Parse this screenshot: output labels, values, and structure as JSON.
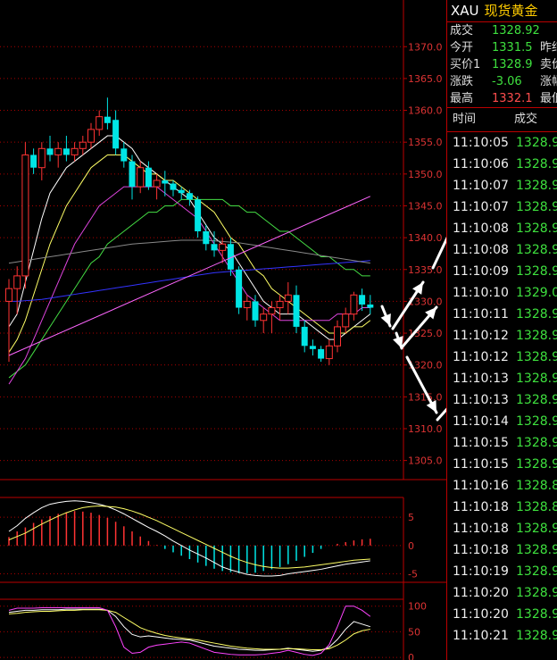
{
  "chart_data": {
    "type": "candlestick",
    "price_axis": {
      "ticks": [
        1370.0,
        1365.0,
        1360.0,
        1355.0,
        1350.0,
        1345.0,
        1340.0,
        1335.0,
        1330.0,
        1325.0,
        1320.0,
        1315.0,
        1310.0,
        1305.0
      ],
      "range": [
        1302.0,
        1372.0
      ]
    },
    "candles": [
      {
        "o": 1330.0,
        "h": 1333.5,
        "l": 1320.5,
        "c": 1332.0
      },
      {
        "o": 1332.0,
        "h": 1335.5,
        "l": 1328.0,
        "c": 1334.0
      },
      {
        "o": 1334.0,
        "h": 1355.0,
        "l": 1332.0,
        "c": 1353.0
      },
      {
        "o": 1353.0,
        "h": 1354.0,
        "l": 1350.0,
        "c": 1351.0
      },
      {
        "o": 1351.0,
        "h": 1355.0,
        "l": 1349.0,
        "c": 1354.0
      },
      {
        "o": 1354.0,
        "h": 1356.0,
        "l": 1352.0,
        "c": 1353.0
      },
      {
        "o": 1353.0,
        "h": 1355.0,
        "l": 1351.0,
        "c": 1354.0
      },
      {
        "o": 1354.0,
        "h": 1356.0,
        "l": 1352.0,
        "c": 1353.0
      },
      {
        "o": 1353.0,
        "h": 1355.0,
        "l": 1352.0,
        "c": 1354.0
      },
      {
        "o": 1354.0,
        "h": 1356.0,
        "l": 1353.0,
        "c": 1355.0
      },
      {
        "o": 1355.0,
        "h": 1358.0,
        "l": 1354.0,
        "c": 1357.0
      },
      {
        "o": 1357.0,
        "h": 1360.0,
        "l": 1356.0,
        "c": 1359.0
      },
      {
        "o": 1359.0,
        "h": 1362.0,
        "l": 1357.0,
        "c": 1358.0
      },
      {
        "o": 1358.5,
        "h": 1360.0,
        "l": 1353.0,
        "c": 1354.0
      },
      {
        "o": 1354.0,
        "h": 1355.0,
        "l": 1351.0,
        "c": 1352.0
      },
      {
        "o": 1352.0,
        "h": 1353.0,
        "l": 1346.0,
        "c": 1348.0
      },
      {
        "o": 1348.0,
        "h": 1352.0,
        "l": 1347.0,
        "c": 1351.0
      },
      {
        "o": 1351.0,
        "h": 1352.0,
        "l": 1347.5,
        "c": 1348.0
      },
      {
        "o": 1348.0,
        "h": 1350.0,
        "l": 1346.0,
        "c": 1349.0
      },
      {
        "o": 1349.0,
        "h": 1350.5,
        "l": 1346.5,
        "c": 1348.5
      },
      {
        "o": 1348.5,
        "h": 1349.0,
        "l": 1346.5,
        "c": 1347.5
      },
      {
        "o": 1347.5,
        "h": 1348.0,
        "l": 1346.0,
        "c": 1347.0
      },
      {
        "o": 1347.0,
        "h": 1347.5,
        "l": 1345.0,
        "c": 1346.0
      },
      {
        "o": 1346.0,
        "h": 1346.5,
        "l": 1340.0,
        "c": 1341.0
      },
      {
        "o": 1341.0,
        "h": 1342.0,
        "l": 1338.0,
        "c": 1339.0
      },
      {
        "o": 1339.0,
        "h": 1341.0,
        "l": 1337.0,
        "c": 1338.0
      },
      {
        "o": 1338.0,
        "h": 1340.0,
        "l": 1336.0,
        "c": 1339.0
      },
      {
        "o": 1339.0,
        "h": 1340.0,
        "l": 1334.0,
        "c": 1335.0
      },
      {
        "o": 1335.0,
        "h": 1335.5,
        "l": 1328.0,
        "c": 1329.0
      },
      {
        "o": 1329.0,
        "h": 1331.0,
        "l": 1327.0,
        "c": 1330.0
      },
      {
        "o": 1330.0,
        "h": 1331.0,
        "l": 1326.0,
        "c": 1327.0
      },
      {
        "o": 1327.0,
        "h": 1329.0,
        "l": 1325.0,
        "c": 1328.0
      },
      {
        "o": 1328.0,
        "h": 1330.0,
        "l": 1325.0,
        "c": 1329.0
      },
      {
        "o": 1329.0,
        "h": 1331.0,
        "l": 1327.0,
        "c": 1330.0
      },
      {
        "o": 1330.0,
        "h": 1333.0,
        "l": 1328.0,
        "c": 1331.0
      },
      {
        "o": 1331.0,
        "h": 1332.5,
        "l": 1325.0,
        "c": 1326.0
      },
      {
        "o": 1326.0,
        "h": 1327.0,
        "l": 1322.0,
        "c": 1323.0
      },
      {
        "o": 1323.0,
        "h": 1324.0,
        "l": 1321.5,
        "c": 1322.5
      },
      {
        "o": 1322.5,
        "h": 1323.0,
        "l": 1320.5,
        "c": 1321.0
      },
      {
        "o": 1321.0,
        "h": 1324.0,
        "l": 1320.0,
        "c": 1323.0
      },
      {
        "o": 1323.0,
        "h": 1327.0,
        "l": 1322.0,
        "c": 1326.0
      },
      {
        "o": 1326.0,
        "h": 1329.0,
        "l": 1325.0,
        "c": 1328.0
      },
      {
        "o": 1328.0,
        "h": 1331.5,
        "l": 1327.0,
        "c": 1331.0
      },
      {
        "o": 1331.0,
        "h": 1332.0,
        "l": 1328.5,
        "c": 1329.5
      },
      {
        "o": 1329.5,
        "h": 1331.0,
        "l": 1328.0,
        "c": 1329.0
      }
    ],
    "moving_averages": [
      {
        "color": "#ffffff",
        "values": [
          1326,
          1328,
          1333,
          1338,
          1343,
          1347,
          1349,
          1351,
          1352,
          1353,
          1354,
          1355,
          1356,
          1356,
          1355,
          1354,
          1352,
          1351,
          1350,
          1349,
          1348,
          1347,
          1346,
          1344,
          1342,
          1340,
          1339,
          1338,
          1336,
          1334,
          1332,
          1330,
          1329,
          1328,
          1328,
          1328,
          1327,
          1326,
          1325,
          1324,
          1324,
          1325,
          1326,
          1327,
          1328
        ]
      },
      {
        "color": "#ffff66",
        "values": [
          1322,
          1324,
          1327,
          1331,
          1335,
          1339,
          1342,
          1345,
          1347,
          1349,
          1351,
          1352,
          1353,
          1353,
          1353,
          1352,
          1351,
          1350,
          1350,
          1349,
          1349,
          1348,
          1347,
          1346,
          1345,
          1344,
          1342,
          1340,
          1339,
          1337,
          1335,
          1334,
          1332,
          1331,
          1330,
          1329,
          1328,
          1327,
          1326,
          1325,
          1325,
          1325,
          1326,
          1326,
          1327
        ]
      },
      {
        "color": "#44dd44",
        "values": [
          1318,
          1319,
          1320,
          1322,
          1324,
          1326,
          1328,
          1330,
          1332,
          1334,
          1336,
          1337,
          1339,
          1340,
          1341,
          1342,
          1343,
          1344,
          1344,
          1345,
          1345,
          1346,
          1346,
          1346,
          1346,
          1346,
          1346,
          1345,
          1345,
          1344,
          1344,
          1343,
          1342,
          1341,
          1341,
          1340,
          1339,
          1338,
          1337,
          1337,
          1336,
          1335,
          1335,
          1334,
          1334
        ]
      },
      {
        "color": "#dd44dd",
        "values": [
          1317,
          1319,
          1321,
          1324,
          1327,
          1330,
          1333,
          1336,
          1339,
          1341,
          1343,
          1345,
          1346,
          1347,
          1348,
          1348,
          1348,
          1348,
          1348,
          1347,
          1346,
          1345,
          1344,
          1343,
          1341,
          1339,
          1337,
          1335,
          1333,
          1331,
          1330,
          1329,
          1328,
          1327,
          1327,
          1327,
          1327,
          1327,
          1327,
          1327,
          1328,
          1328,
          1328,
          1329,
          1329
        ]
      },
      {
        "color": "#3333ff",
        "values": [
          1330,
          1330,
          1330.1,
          1330.2,
          1330.3,
          1330.5,
          1330.7,
          1330.9,
          1331.1,
          1331.3,
          1331.5,
          1331.7,
          1331.9,
          1332.1,
          1332.3,
          1332.5,
          1332.7,
          1332.9,
          1333.1,
          1333.3,
          1333.5,
          1333.7,
          1333.9,
          1334.1,
          1334.3,
          1334.5,
          1334.6,
          1334.7,
          1334.8,
          1334.9,
          1335.0,
          1335.1,
          1335.2,
          1335.3,
          1335.4,
          1335.5,
          1335.6,
          1335.7,
          1335.8,
          1335.9,
          1336.0,
          1336.1,
          1336.2,
          1336.3,
          1336.4
        ]
      },
      {
        "color": "#888888",
        "values": [
          1336,
          1336.2,
          1336.4,
          1336.6,
          1336.8,
          1337,
          1337.2,
          1337.4,
          1337.6,
          1337.8,
          1338,
          1338.2,
          1338.4,
          1338.6,
          1338.8,
          1339,
          1339.1,
          1339.2,
          1339.3,
          1339.4,
          1339.5,
          1339.6,
          1339.6,
          1339.6,
          1339.6,
          1339.5,
          1339.4,
          1339.3,
          1339.2,
          1339.0,
          1338.8,
          1338.6,
          1338.4,
          1338.2,
          1338.0,
          1337.8,
          1337.6,
          1337.4,
          1337.2,
          1337.0,
          1336.8,
          1336.6,
          1336.4,
          1336.2,
          1336.0
        ]
      }
    ],
    "trendline": {
      "color": "#ff66ff",
      "from": {
        "index": 0,
        "price": 1321.5
      },
      "to": {
        "index": 44,
        "price": 1346.5
      }
    },
    "macd": {
      "axis_ticks": [
        "5",
        "0",
        "-5"
      ],
      "range": [
        -6.5,
        8.5
      ],
      "histogram": [
        1.5,
        2.5,
        3.2,
        4,
        4.6,
        5.2,
        5.6,
        5.9,
        6.1,
        6.0,
        5.8,
        5.4,
        4.9,
        4.2,
        3.4,
        2.5,
        1.6,
        0.8,
        0.1,
        -0.6,
        -1.2,
        -1.8,
        -2.4,
        -3.0,
        -3.6,
        -4.1,
        -4.5,
        -4.7,
        -4.9,
        -4.9,
        -4.8,
        -4.5,
        -4.2,
        -3.8,
        -3.3,
        -2.7,
        -2.0,
        -1.3,
        -0.6,
        0.0,
        0.3,
        0.6,
        0.9,
        1.1,
        1.2
      ],
      "dif": [
        2.5,
        3.5,
        4.8,
        5.8,
        6.7,
        7.3,
        7.6,
        7.8,
        7.9,
        7.8,
        7.6,
        7.3,
        6.9,
        6.3,
        5.6,
        4.8,
        4.0,
        3.2,
        2.5,
        1.7,
        0.8,
        0,
        -0.8,
        -1.5,
        -2.2,
        -3,
        -3.8,
        -4.3,
        -4.7,
        -5.1,
        -5.3,
        -5.4,
        -5.4,
        -5.3,
        -5.0,
        -4.8,
        -4.6,
        -4.4,
        -4.2,
        -3.9,
        -3.6,
        -3.3,
        -3.1,
        -2.9,
        -2.7
      ],
      "dea": [
        1.0,
        1.6,
        2.2,
        3.0,
        3.8,
        4.5,
        5.2,
        5.8,
        6.3,
        6.7,
        6.9,
        7.0,
        6.9,
        6.8,
        6.5,
        6.1,
        5.6,
        5.0,
        4.4,
        3.7,
        3.0,
        2.3,
        1.6,
        0.9,
        0.2,
        -0.5,
        -1.2,
        -1.9,
        -2.5,
        -3.0,
        -3.4,
        -3.7,
        -3.9,
        -4.0,
        -4.0,
        -3.9,
        -3.8,
        -3.6,
        -3.4,
        -3.2,
        -3.0,
        -2.8,
        -2.6,
        -2.5,
        -2.4
      ]
    },
    "kdj": {
      "axis_ticks": [
        "100",
        "50",
        "0"
      ],
      "range": [
        -5,
        110
      ],
      "k": [
        88,
        90,
        92,
        92,
        93,
        93,
        93,
        94,
        94,
        94,
        94,
        94,
        92,
        80,
        60,
        45,
        40,
        42,
        40,
        38,
        36,
        35,
        34,
        30,
        26,
        22,
        20,
        18,
        16,
        15,
        14,
        14,
        15,
        16,
        18,
        16,
        14,
        12,
        14,
        20,
        35,
        55,
        70,
        65,
        60
      ],
      "d": [
        85,
        86,
        88,
        89,
        90,
        90,
        91,
        92,
        92,
        93,
        93,
        93,
        92,
        88,
        78,
        68,
        58,
        52,
        47,
        43,
        40,
        38,
        36,
        34,
        31,
        28,
        25,
        22,
        20,
        18,
        17,
        16,
        16,
        16,
        17,
        17,
        16,
        15,
        15,
        17,
        24,
        34,
        46,
        52,
        55
      ],
      "j": [
        92,
        96,
        96,
        96,
        97,
        97,
        97,
        97,
        97,
        97,
        97,
        97,
        92,
        60,
        20,
        8,
        10,
        20,
        24,
        26,
        28,
        30,
        28,
        22,
        16,
        10,
        8,
        6,
        5,
        5,
        5,
        6,
        8,
        10,
        14,
        10,
        6,
        4,
        8,
        25,
        60,
        100,
        100,
        92,
        80
      ]
    }
  },
  "arrows": {
    "color": "#ffffff"
  },
  "quote": {
    "code": "XAU",
    "name": "现货黄金",
    "rows": [
      {
        "label": "成交",
        "value": "1328.92",
        "value_color": "green",
        "label2": ""
      },
      {
        "label": "今开",
        "value": "1331.5",
        "value_color": "green",
        "label2": "昨结"
      },
      {
        "label": "买价1",
        "value": "1328.9",
        "value_color": "green",
        "label2": "卖价"
      },
      {
        "label": "涨跌",
        "value": "-3.06",
        "value_color": "green",
        "label2": "涨幅"
      },
      {
        "label": "最高",
        "value": "1332.1",
        "value_color": "red",
        "label2": "最低"
      }
    ]
  },
  "ticks_table": {
    "header_time": "时间",
    "header_price": "成交",
    "rows": [
      {
        "time": "11:10:05",
        "price": "1328.9",
        "color": "green"
      },
      {
        "time": "11:10:06",
        "price": "1328.9",
        "color": "green"
      },
      {
        "time": "11:10:07",
        "price": "1328.9",
        "color": "green"
      },
      {
        "time": "11:10:07",
        "price": "1328.9",
        "color": "green"
      },
      {
        "time": "11:10:08",
        "price": "1328.9",
        "color": "green"
      },
      {
        "time": "11:10:08",
        "price": "1328.9",
        "color": "green"
      },
      {
        "time": "11:10:09",
        "price": "1328.9",
        "color": "green"
      },
      {
        "time": "11:10:10",
        "price": "1329.0",
        "color": "green"
      },
      {
        "time": "11:10:11",
        "price": "1328.9",
        "color": "green"
      },
      {
        "time": "11:10:12",
        "price": "1328.9",
        "color": "green"
      },
      {
        "time": "11:10:12",
        "price": "1328.9",
        "color": "green"
      },
      {
        "time": "11:10:13",
        "price": "1328.9",
        "color": "green"
      },
      {
        "time": "11:10:13",
        "price": "1328.9",
        "color": "green"
      },
      {
        "time": "11:10:14",
        "price": "1328.9",
        "color": "green"
      },
      {
        "time": "11:10:15",
        "price": "1328.9",
        "color": "green"
      },
      {
        "time": "11:10:15",
        "price": "1328.9",
        "color": "green"
      },
      {
        "time": "11:10:16",
        "price": "1328.8",
        "color": "green"
      },
      {
        "time": "11:10:18",
        "price": "1328.8",
        "color": "green"
      },
      {
        "time": "11:10:18",
        "price": "1328.9",
        "color": "green"
      },
      {
        "time": "11:10:18",
        "price": "1328.9",
        "color": "green"
      },
      {
        "time": "11:10:19",
        "price": "1328.9",
        "color": "green"
      },
      {
        "time": "11:10:20",
        "price": "1328.9",
        "color": "green"
      },
      {
        "time": "11:10:20",
        "price": "1328.9",
        "color": "green"
      },
      {
        "time": "11:10:21",
        "price": "1328.9",
        "color": "green"
      }
    ]
  }
}
